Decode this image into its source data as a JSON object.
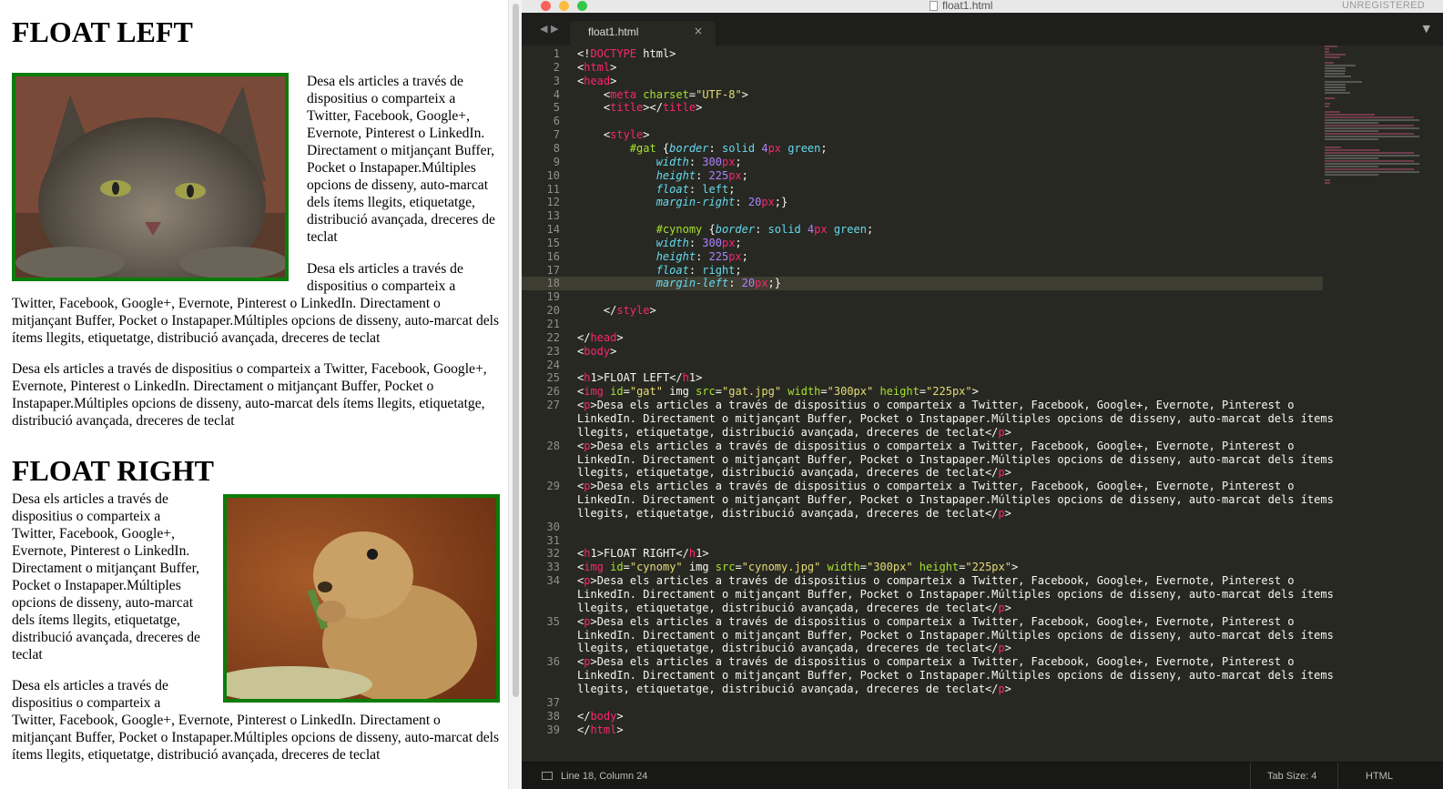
{
  "preview": {
    "h1_left": "FLOAT LEFT",
    "h1_right": "FLOAT RIGHT",
    "paragraph": "Desa els articles a través de dispositius o comparteix a Twitter, Facebook, Google+, Evernote, Pinterest o LinkedIn. Directament o mitjançant Buffer, Pocket o Instapaper.Múltiples opcions de disseny, auto-marcat dels ítems llegits, etiquetatge, distribució avançada, dreceres de teclat",
    "images": [
      "cat-photo",
      "prairie-dog-photo"
    ],
    "border_color": "#0a7d0a"
  },
  "editor": {
    "window_title": "float1.html",
    "unregistered": "UNREGISTERED",
    "tab_label": "float1.html",
    "tab_close": "×",
    "nav_arrows": "◀ ▶",
    "dropdown": "▼",
    "traffic_colors": [
      "#fc605b",
      "#fdbc40",
      "#34c84a"
    ],
    "status_position": "Line 18, Column 24",
    "status_tab_size": "Tab Size: 4",
    "status_syntax": "HTML",
    "lines": [
      {
        "n": "1",
        "code": "<!DOCTYPE html>"
      },
      {
        "n": "2",
        "code": "<html>"
      },
      {
        "n": "3",
        "code": "<head>"
      },
      {
        "n": "4",
        "code": "    <meta charset=\"UTF-8\">"
      },
      {
        "n": "5",
        "code": "    <title></title>"
      },
      {
        "n": "6",
        "code": ""
      },
      {
        "n": "7",
        "code": "    <style>"
      },
      {
        "n": "8",
        "code": "        #gat {border: solid 4px green;"
      },
      {
        "n": "9",
        "code": "            width: 300px;"
      },
      {
        "n": "10",
        "code": "            height: 225px;"
      },
      {
        "n": "11",
        "code": "            float: left;"
      },
      {
        "n": "12",
        "code": "            margin-right: 20px;}"
      },
      {
        "n": "13",
        "code": ""
      },
      {
        "n": "14",
        "code": "            #cynomy {border: solid 4px green;"
      },
      {
        "n": "15",
        "code": "            width: 300px;"
      },
      {
        "n": "16",
        "code": "            height: 225px;"
      },
      {
        "n": "17",
        "code": "            float: right;"
      },
      {
        "n": "18",
        "code": "            margin-left: 20px;}"
      },
      {
        "n": "19",
        "code": ""
      },
      {
        "n": "20",
        "code": "    </style>"
      },
      {
        "n": "21",
        "code": ""
      },
      {
        "n": "22",
        "code": "</head>"
      },
      {
        "n": "23",
        "code": "<body>"
      },
      {
        "n": "24",
        "code": ""
      },
      {
        "n": "25",
        "code": "<h1>FLOAT LEFT</h1>"
      },
      {
        "n": "26",
        "code": "<img id=\"gat\" img src=\"gat.jpg\" width=\"300px\" height=\"225px\">"
      },
      {
        "n": "27",
        "code": "<p>Desa els articles a través de dispositius o comparteix a Twitter, Facebook, Google+, Evernote, Pinterest o"
      },
      {
        "n": "",
        "code": "LinkedIn. Directament o mitjançant Buffer, Pocket o Instapaper.Múltiples opcions de disseny, auto-marcat dels ítems"
      },
      {
        "n": "",
        "code": "llegits, etiquetatge, distribució avançada, dreceres de teclat</p>"
      },
      {
        "n": "28",
        "code": "<p>Desa els articles a través de dispositius o comparteix a Twitter, Facebook, Google+, Evernote, Pinterest o"
      },
      {
        "n": "",
        "code": "LinkedIn. Directament o mitjançant Buffer, Pocket o Instapaper.Múltiples opcions de disseny, auto-marcat dels ítems"
      },
      {
        "n": "",
        "code": "llegits, etiquetatge, distribució avançada, dreceres de teclat</p>"
      },
      {
        "n": "29",
        "code": "<p>Desa els articles a través de dispositius o comparteix a Twitter, Facebook, Google+, Evernote, Pinterest o"
      },
      {
        "n": "",
        "code": "LinkedIn. Directament o mitjançant Buffer, Pocket o Instapaper.Múltiples opcions de disseny, auto-marcat dels ítems"
      },
      {
        "n": "",
        "code": "llegits, etiquetatge, distribució avançada, dreceres de teclat</p>"
      },
      {
        "n": "30",
        "code": ""
      },
      {
        "n": "31",
        "code": ""
      },
      {
        "n": "32",
        "code": "<h1>FLOAT RIGHT</h1>"
      },
      {
        "n": "33",
        "code": "<img id=\"cynomy\" img src=\"cynomy.jpg\" width=\"300px\" height=\"225px\">"
      },
      {
        "n": "34",
        "code": "<p>Desa els articles a través de dispositius o comparteix a Twitter, Facebook, Google+, Evernote, Pinterest o"
      },
      {
        "n": "",
        "code": "LinkedIn. Directament o mitjançant Buffer, Pocket o Instapaper.Múltiples opcions de disseny, auto-marcat dels ítems"
      },
      {
        "n": "",
        "code": "llegits, etiquetatge, distribució avançada, dreceres de teclat</p>"
      },
      {
        "n": "35",
        "code": "<p>Desa els articles a través de dispositius o comparteix a Twitter, Facebook, Google+, Evernote, Pinterest o"
      },
      {
        "n": "",
        "code": "LinkedIn. Directament o mitjançant Buffer, Pocket o Instapaper.Múltiples opcions de disseny, auto-marcat dels ítems"
      },
      {
        "n": "",
        "code": "llegits, etiquetatge, distribució avançada, dreceres de teclat</p>"
      },
      {
        "n": "36",
        "code": "<p>Desa els articles a través de dispositius o comparteix a Twitter, Facebook, Google+, Evernote, Pinterest o"
      },
      {
        "n": "",
        "code": "LinkedIn. Directament o mitjançant Buffer, Pocket o Instapaper.Múltiples opcions de disseny, auto-marcat dels ítems"
      },
      {
        "n": "",
        "code": "llegits, etiquetatge, distribució avançada, dreceres de teclat</p>"
      },
      {
        "n": "37",
        "code": ""
      },
      {
        "n": "38",
        "code": "</body>"
      },
      {
        "n": "39",
        "code": "</html>"
      }
    ]
  }
}
